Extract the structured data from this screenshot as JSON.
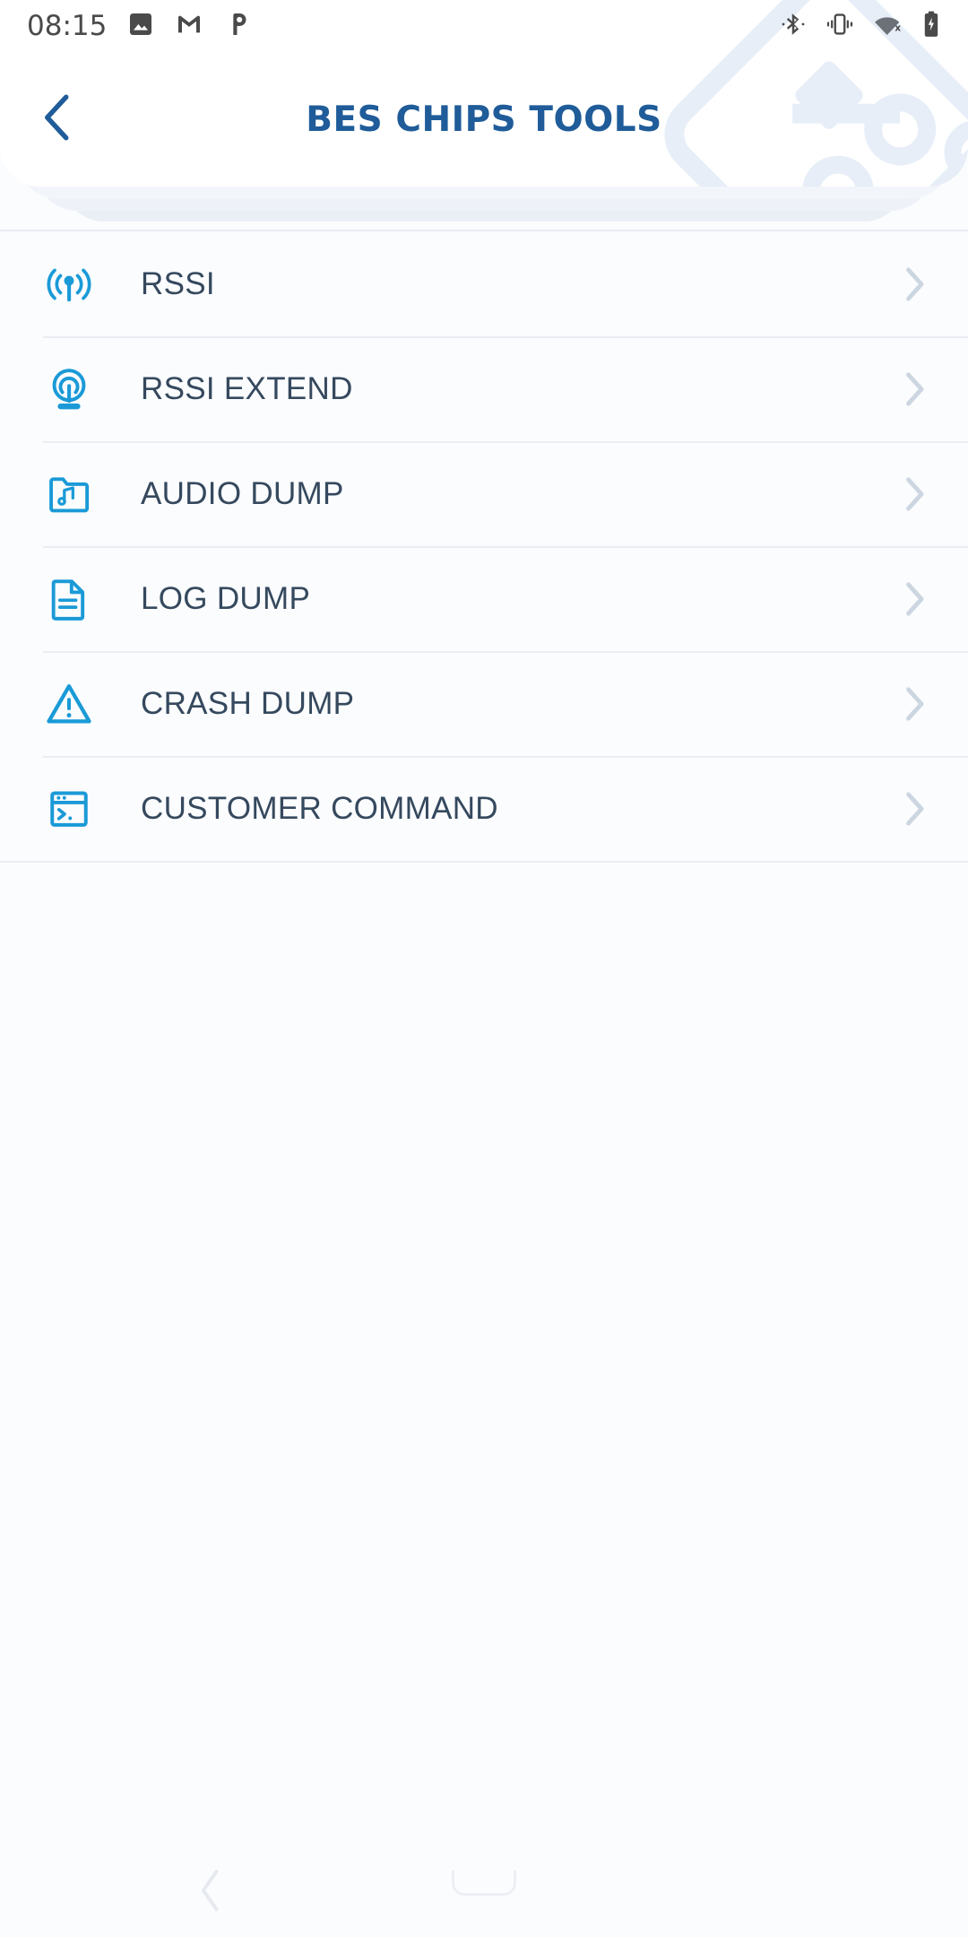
{
  "status_bar": {
    "time": "08:15",
    "left_icons": [
      {
        "name": "gallery-icon"
      },
      {
        "name": "gmail-icon"
      },
      {
        "name": "pocketcasts-icon"
      }
    ],
    "right_icons": [
      {
        "name": "bluetooth-icon"
      },
      {
        "name": "vibrate-icon"
      },
      {
        "name": "wifi-off-icon"
      },
      {
        "name": "battery-charging-icon"
      }
    ]
  },
  "header": {
    "title": "BES CHIPS TOOLS",
    "back_icon": "chevron-left-icon",
    "watermark_icon": "circuit-chip-watermark",
    "title_color": "#1f5c99"
  },
  "colors": {
    "accent_blue": "#1a9ad7",
    "title_blue": "#1f5c99",
    "label_text": "#35495e",
    "chevron": "#ccd6e1",
    "divider": "#e9edf2",
    "page_bg": "#fbfcfe"
  },
  "list": {
    "items": [
      {
        "label": "RSSI",
        "icon": "antenna-signal-icon",
        "chevron": "chevron-right-icon"
      },
      {
        "label": "RSSI EXTEND",
        "icon": "broadcast-tower-icon",
        "chevron": "chevron-right-icon"
      },
      {
        "label": "AUDIO DUMP",
        "icon": "folder-music-icon",
        "chevron": "chevron-right-icon"
      },
      {
        "label": "LOG DUMP",
        "icon": "document-lines-icon",
        "chevron": "chevron-right-icon"
      },
      {
        "label": "CRASH DUMP",
        "icon": "warning-triangle-icon",
        "chevron": "chevron-right-icon"
      },
      {
        "label": "CUSTOMER COMMAND",
        "icon": "terminal-window-icon",
        "chevron": "chevron-right-icon"
      }
    ]
  },
  "nav_bar": {
    "back_icon": "nav-back-icon",
    "home_icon": "nav-home-indicator"
  }
}
